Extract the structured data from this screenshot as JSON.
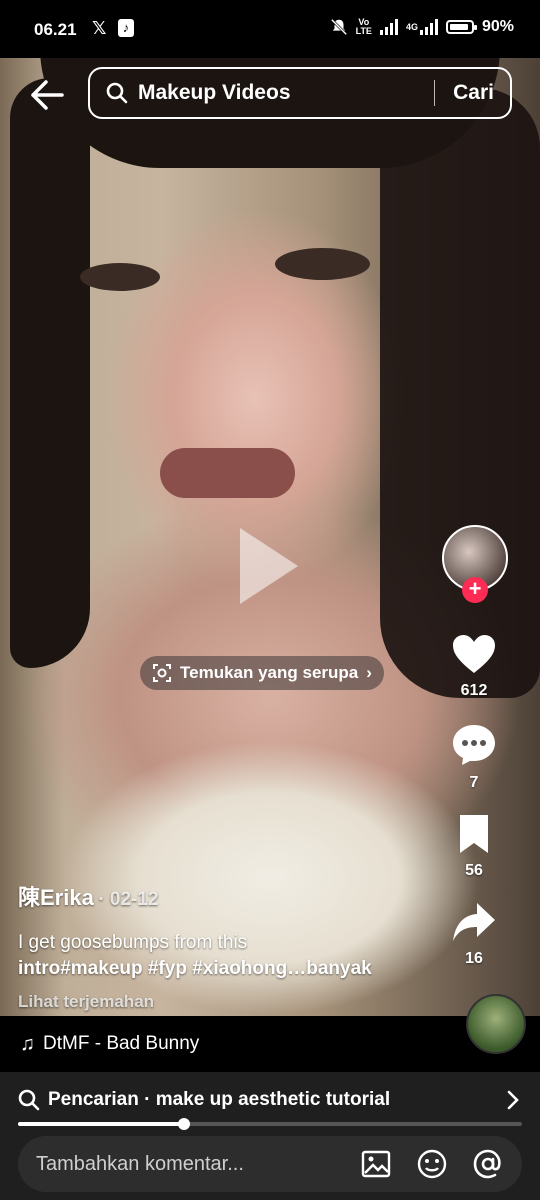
{
  "status_bar": {
    "time": "06.21",
    "app_x": "𝕏",
    "app_tiktok": "♪",
    "volte": "Vo",
    "lte": "LTE",
    "network": "4G",
    "battery": "90%",
    "battery_level": 0.9
  },
  "search": {
    "query": "Makeup Videos",
    "submit_label": "Cari"
  },
  "find_similar": {
    "label": "Temukan yang serupa"
  },
  "rail": {
    "likes": "612",
    "comments": "7",
    "saves": "56",
    "shares": "16"
  },
  "caption": {
    "author": "陳Erika",
    "date": "· 02-12",
    "line1": "I get goosebumps from this",
    "line2_tags": "intro#makeup #fyp #xiaohong…",
    "more": "banyak",
    "translate": "Lihat terjemahan"
  },
  "music": {
    "title": "DtMF - Bad Bunny"
  },
  "suggestion": {
    "text": "Pencarian · make up aesthetic tutorial"
  },
  "playback": {
    "progress": 0.33
  },
  "comment": {
    "placeholder": "Tambahkan komentar..."
  },
  "icons": {
    "back": "arrow-left-icon",
    "search": "search-icon",
    "heart": "heart-icon",
    "comment": "comment-icon",
    "bookmark": "bookmark-icon",
    "share": "share-icon",
    "image": "image-icon",
    "emoji": "emoji-icon",
    "mention": "at-icon"
  },
  "colors": {
    "accent": "#fe2c55",
    "background": "#000000",
    "bar": "#1f1f1f"
  }
}
